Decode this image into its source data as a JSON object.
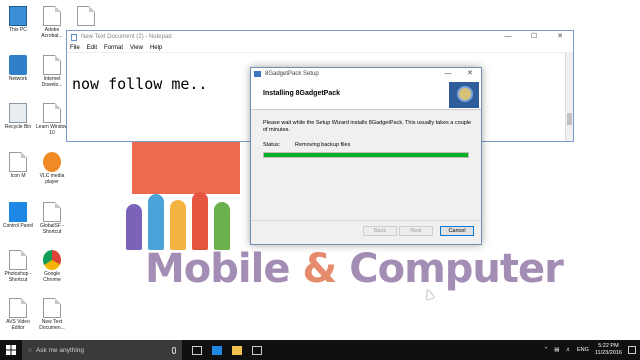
{
  "desktop_icons": [
    {
      "label": "This PC",
      "icon": "this-pc-icon"
    },
    {
      "label": "Adobe Acrobat...",
      "icon": "document-icon"
    },
    {
      "label": "Network",
      "icon": "network-icon"
    },
    {
      "label": "Internet Downlo...",
      "icon": "document-icon"
    },
    {
      "label": "Recycle Bin",
      "icon": "recycle-bin-icon"
    },
    {
      "label": "Learn Window 10",
      "icon": "document-icon"
    },
    {
      "label": "Icon M",
      "icon": "document-icon"
    },
    {
      "label": "VLC media player",
      "icon": "vlc-icon"
    },
    {
      "label": "Control Panel",
      "icon": "control-panel-icon"
    },
    {
      "label": "GlobalSF - Shortcut",
      "icon": "document-icon"
    },
    {
      "label": "Photoshop - Shortcut",
      "icon": "document-icon"
    },
    {
      "label": "Google Chrome",
      "icon": "chrome-icon"
    },
    {
      "label": "AVS Video Editor",
      "icon": "document-icon"
    },
    {
      "label": "New Text Documen...",
      "icon": "document-icon"
    }
  ],
  "notepad": {
    "title": "New Text Document (2) - Notepad",
    "menu": [
      "File",
      "Edit",
      "Format",
      "View",
      "Help"
    ],
    "content": "now follow me..",
    "controls": {
      "minimize": "—",
      "maximize": "☐",
      "close": "✕"
    }
  },
  "setup": {
    "title": "8GadgetPack Setup",
    "heading": "Installing 8GadgetPack",
    "description": "Please wait while the Setup Wizard installs 8GadgetPack. This usually takes a couple of minutes.",
    "status_label": "Status:",
    "status_value": "Removing backup files",
    "progress_percent": 100,
    "buttons": {
      "back": "Back",
      "next": "Next",
      "cancel": "Cancel"
    },
    "controls": {
      "minimize": "—",
      "close": "✕"
    }
  },
  "background_logo": {
    "word1": "Mobile",
    "amp": "&",
    "word2": "Computer"
  },
  "taskbar": {
    "search_placeholder": "Ask me anything",
    "language": "ENG",
    "time": "5:22 PM",
    "date": "11/23/2016"
  },
  "colors": {
    "progress": "#06b025",
    "accent": "#0078d7",
    "taskbar": "#101010"
  }
}
